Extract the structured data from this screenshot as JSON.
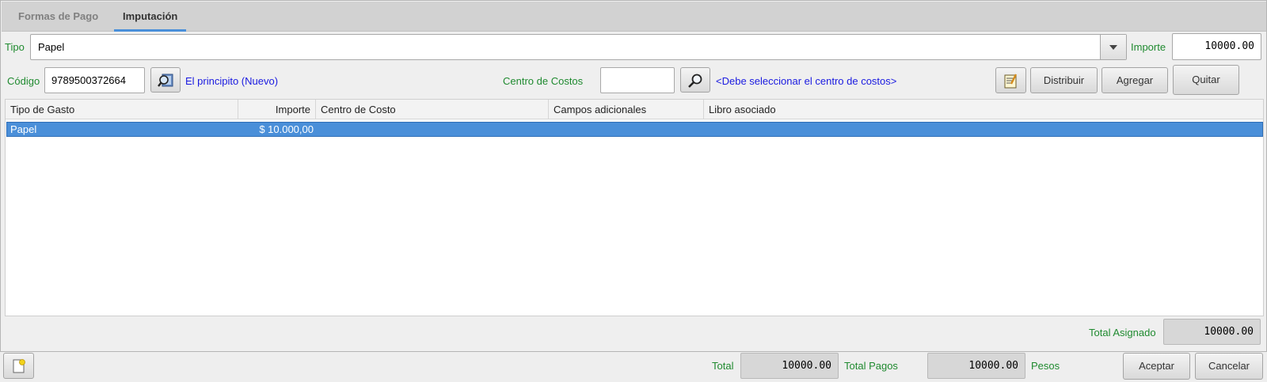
{
  "tabs": [
    {
      "label": "Formas de Pago"
    },
    {
      "label": "Imputación"
    }
  ],
  "tipo": {
    "label": "Tipo",
    "value": "Papel"
  },
  "importe": {
    "label": "Importe",
    "value": "10000.00"
  },
  "codigo": {
    "label": "Código",
    "value": "9789500372664",
    "description": "El principito (Nuevo)"
  },
  "centro": {
    "label": "Centro de Costos",
    "value": "",
    "message": "<Debe seleccionar el centro de costos>"
  },
  "actions": {
    "distribuir": "Distribuir",
    "agregar": "Agregar",
    "quitar": "Quitar"
  },
  "table": {
    "columns": [
      "Tipo de Gasto",
      "Importe",
      "Centro de Costo",
      "Campos adicionales",
      "Libro asociado"
    ],
    "rows": [
      {
        "tipo_gasto": "Papel",
        "importe": "$ 10.000,00",
        "centro": "",
        "campos": "",
        "libro": ""
      }
    ]
  },
  "total_asignado": {
    "label": "Total Asignado",
    "value": "10000.00"
  },
  "footer": {
    "total_label": "Total",
    "total_value": "10000.00",
    "total_pagos_label": "Total Pagos",
    "total_pagos_value": "10000.00",
    "currency": "Pesos",
    "aceptar": "Aceptar",
    "cancelar": "Cancelar"
  },
  "colors": {
    "label_green": "#1f8a2f",
    "link_blue": "#1a1ae0",
    "selection": "#4a8fd9"
  },
  "icons": [
    "search-book-icon",
    "search-icon",
    "notes-icon",
    "new-document-icon",
    "dropdown-arrow-icon"
  ]
}
